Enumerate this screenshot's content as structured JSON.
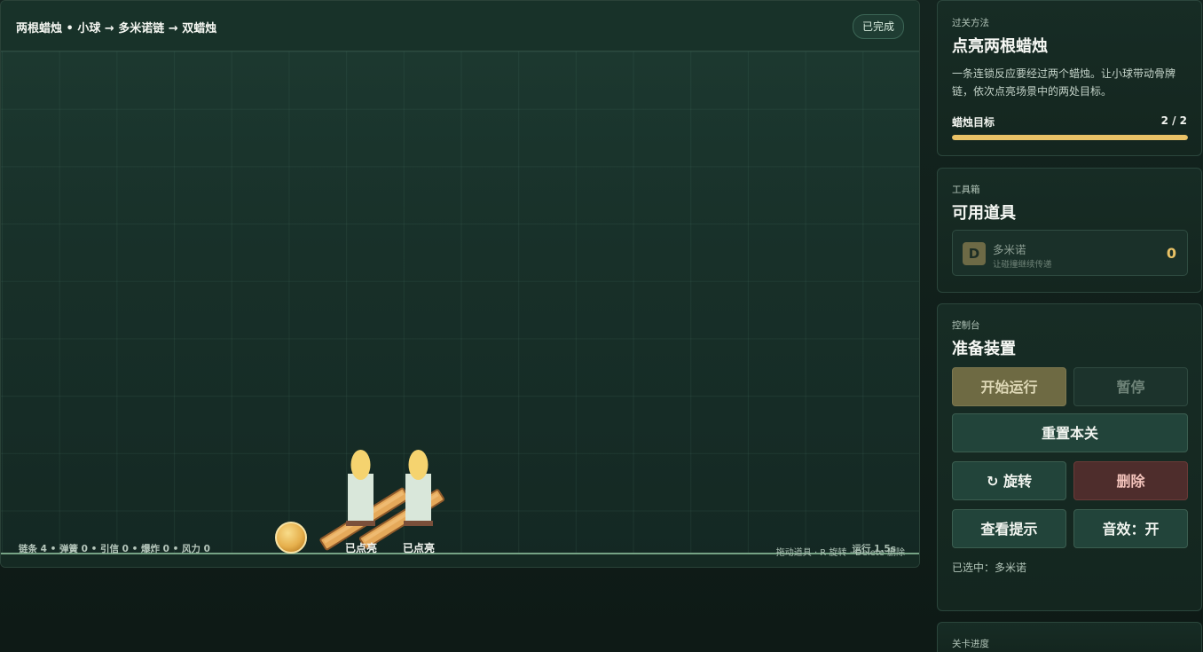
{
  "stage": {
    "title": "两根蜡烛 • 小球 → 多米诺链 → 双蜡烛",
    "status": "已完成",
    "stats": "链条 4 • 弹簧 0 • 引信 0 • 爆炸 0 • 风力 0",
    "controls_hint": "拖动道具 · R 旋转 · Delete 删除",
    "runtime": "运行 1.5s",
    "candles": [
      {
        "label": "已点亮",
        "lit": true
      },
      {
        "label": "已点亮",
        "lit": true
      }
    ]
  },
  "goal": {
    "kicker": "过关方法",
    "title": "点亮两根蜡烛",
    "description": "一条连锁反应要经过两个蜡烛。让小球带动骨牌链，依次点亮场景中的两处目标。",
    "target_label": "蜡烛目标",
    "target_count": "2 / 2",
    "progress": 1.0
  },
  "toolbox": {
    "kicker": "工具箱",
    "title": "可用道具",
    "tools": [
      {
        "badge": "D",
        "name": "多米诺",
        "subtitle": "让碰撞继续传递",
        "count": "0"
      }
    ]
  },
  "console": {
    "kicker": "控制台",
    "title": "准备装置",
    "start_label": "开始运行",
    "pause_label": "暂停",
    "reset_label": "重置本关",
    "rotate_label": "↻ 旋转",
    "delete_label": "删除",
    "hint_label": "查看提示",
    "sound_label": "音效：开",
    "selected_text": "已选中：多米诺"
  },
  "progress_panel": {
    "kicker": "关卡进度"
  },
  "colors": {
    "accent": "#e9c266",
    "ground": "#76a385",
    "flame": "#f5d36f",
    "danger": "#4e2d2c"
  }
}
